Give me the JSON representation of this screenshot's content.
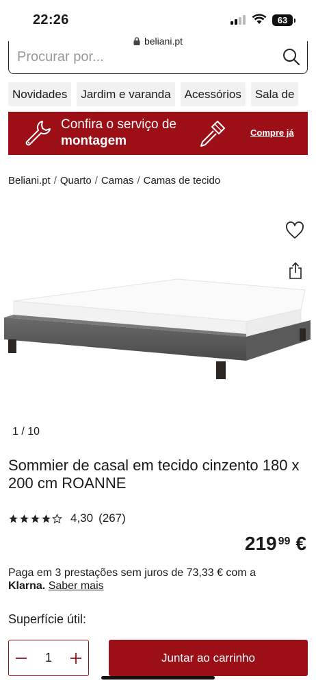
{
  "status_bar": {
    "time": "22:26",
    "battery": "63"
  },
  "browser": {
    "domain": "beliani.pt"
  },
  "search": {
    "placeholder": "Procurar por..."
  },
  "categories": [
    "Novidades",
    "Jardim e varanda",
    "Acessórios",
    "Sala de"
  ],
  "banner": {
    "line1": "Confira o serviço de",
    "line2": "montagem",
    "cta": "Compre já"
  },
  "breadcrumb": [
    "Beliani.pt",
    "Quarto",
    "Camas",
    "Camas de tecido"
  ],
  "gallery": {
    "current": "1",
    "total": "10"
  },
  "product": {
    "title": "Sommier de casal em tecido cinzento 180 x 200 cm ROANNE",
    "rating": "4,30",
    "review_count": "(267)",
    "stars_filled": 4,
    "price_main": "219",
    "price_cents": "99",
    "currency": "€"
  },
  "klarna": {
    "text": "Paga em 3 prestações sem juros de 73,33 € com a",
    "brand": "Klarna.",
    "link": "Saber mais"
  },
  "surface_label": "Superfície útil:",
  "cart": {
    "quantity": "1",
    "add_label": "Juntar ao carrinho"
  },
  "colors": {
    "brand": "#9c0f17",
    "chip_bg": "#f1f1f1"
  }
}
